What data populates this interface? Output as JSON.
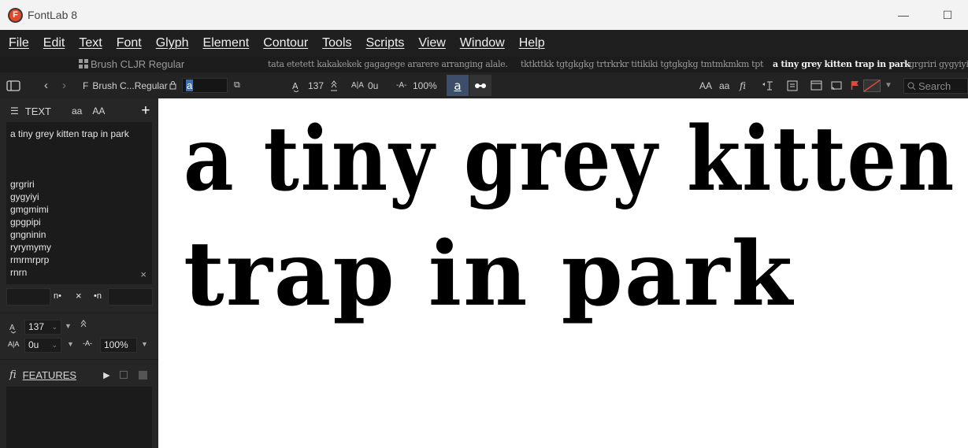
{
  "app": {
    "logo_letter": "F",
    "title": "FontLab 8"
  },
  "window_controls": {
    "minimize": "—",
    "maximize": "☐"
  },
  "menu": [
    "File",
    "Edit",
    "Text",
    "Font",
    "Glyph",
    "Element",
    "Contour",
    "Tools",
    "Scripts",
    "View",
    "Window",
    "Help"
  ],
  "tabs": {
    "font_tab": "Brush CLJR Regular",
    "text_tabs": [
      {
        "label": "tata etetett kakakekek gagagege ararere arranging alale.",
        "active": false
      },
      {
        "label": "tktkttkk tgtgkgkg trtrkrkr titikiki tgtgkgkg tmtmkmkm tpt",
        "active": false
      },
      {
        "label": "a tiny grey kitten trap in park",
        "active": true
      },
      {
        "label": "grgriri gygyiyi",
        "active": false
      }
    ]
  },
  "toolbar": {
    "font_name": "Brush C...Regular",
    "glyph_value": "a",
    "font_size": "137",
    "tracking": "0u",
    "zoom": "100%",
    "active_glyph": "a",
    "case_upper": "AA",
    "case_lower": "aa",
    "search_placeholder": "Search"
  },
  "sidebar": {
    "text_panel": {
      "title": "TEXT",
      "lower_btn": "aa",
      "upper_btn": "AA",
      "add_btn": "+",
      "lines": [
        "a tiny grey kitten trap in park",
        "",
        "",
        "",
        "grgriri",
        "gygyiyi",
        "gmgmimi",
        "gpgpipi",
        "gngninin",
        "ryrymymy",
        "rmrmrprp",
        "rnrn"
      ],
      "clear_btn": "×",
      "prefix_label": "n•",
      "swap_btn": "×",
      "suffix_label": "•n"
    },
    "metrics": {
      "font_size": "137",
      "tracking": "0u",
      "zoom": "100%"
    },
    "features": {
      "title": "FEATURES"
    }
  },
  "canvas": {
    "lines": [
      "a tiny grey kitten",
      "trap in park"
    ]
  },
  "colors": {
    "accent": "#3d4e6b",
    "logo": "#e24a2b",
    "flag": "#e0483a"
  }
}
